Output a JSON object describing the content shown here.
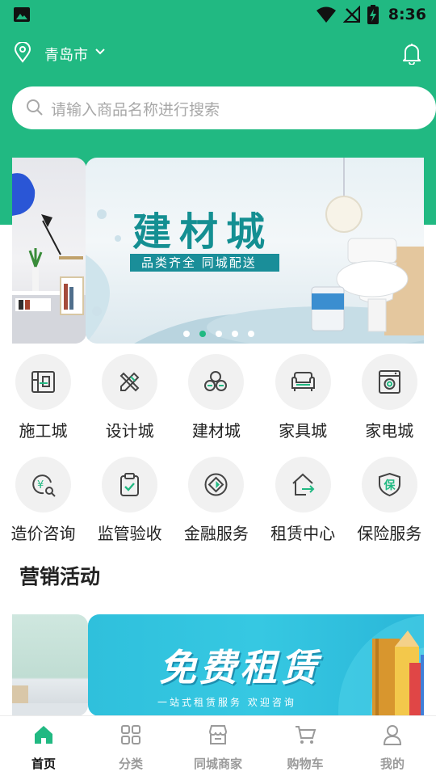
{
  "colors": {
    "brand": "#21b982",
    "banner_text": "#148f92",
    "tab_inactive": "#9a9a9a",
    "icon_gray": "#444444"
  },
  "status_bar": {
    "time": "8:36",
    "icons": [
      "image-icon",
      "wifi-icon",
      "no-signal-icon",
      "battery-charging-icon"
    ]
  },
  "header": {
    "city": "青岛市"
  },
  "search": {
    "placeholder": "请输入商品名称进行搜索"
  },
  "banner": {
    "title": "建材城",
    "subtitle": "品类齐全  同城配送",
    "page_count": 5,
    "active_index": 1
  },
  "categories": [
    {
      "label": "施工城",
      "icon": "blueprint-icon"
    },
    {
      "label": "设计城",
      "icon": "design-tools-icon"
    },
    {
      "label": "建材城",
      "icon": "materials-icon"
    },
    {
      "label": "家具城",
      "icon": "sofa-icon"
    },
    {
      "label": "家电城",
      "icon": "washing-machine-icon"
    },
    {
      "label": "造价咨询",
      "icon": "price-search-icon"
    },
    {
      "label": "监管验收",
      "icon": "clipboard-check-icon"
    },
    {
      "label": "金融服务",
      "icon": "finance-icon"
    },
    {
      "label": "租赁中心",
      "icon": "house-arrow-icon"
    },
    {
      "label": "保险服务",
      "icon": "shield-insurance-icon"
    }
  ],
  "section": {
    "marketing_title": "营销活动"
  },
  "promo": {
    "title": "免费租赁",
    "subtitle": "一站式租赁服务  欢迎咨询"
  },
  "tabbar": [
    {
      "label": "首页",
      "icon": "home-icon",
      "active": true
    },
    {
      "label": "分类",
      "icon": "grid-icon",
      "active": false
    },
    {
      "label": "同城商家",
      "icon": "store-icon",
      "active": false
    },
    {
      "label": "购物车",
      "icon": "cart-icon",
      "active": false
    },
    {
      "label": "我的",
      "icon": "user-icon",
      "active": false
    }
  ]
}
